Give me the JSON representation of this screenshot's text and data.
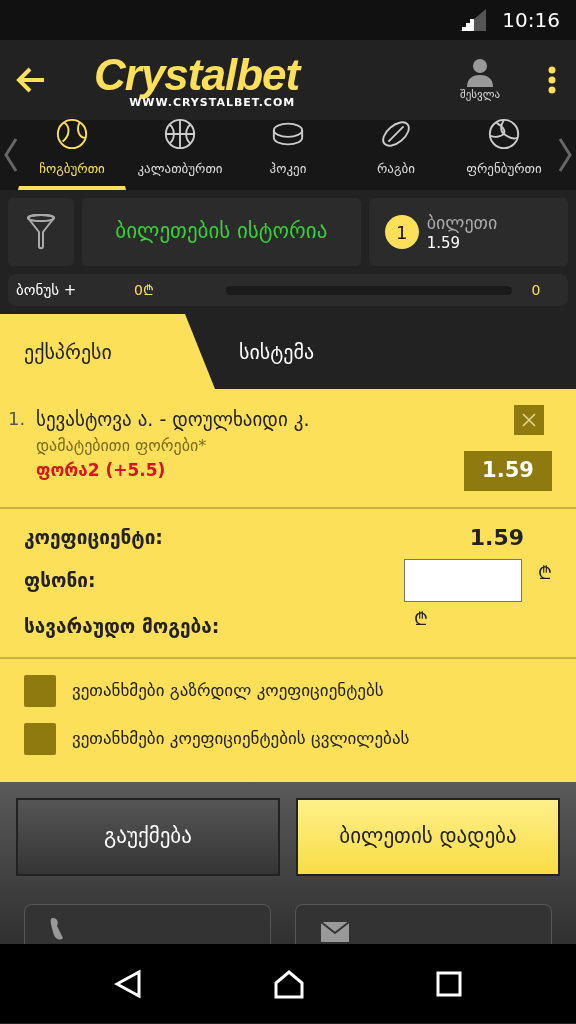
{
  "status_bar": {
    "time": "10:16"
  },
  "header": {
    "logo": "Crystalbet",
    "site": "WWW.CRYSTALBET.COM",
    "login": "შესვლა"
  },
  "sports": [
    {
      "kind": "tennis",
      "label": "ჩოგბურთი",
      "selected": true
    },
    {
      "kind": "basketball",
      "label": "კალათბურთი",
      "selected": false
    },
    {
      "kind": "hockey",
      "label": "ჰოკეი",
      "selected": false
    },
    {
      "kind": "rugby",
      "label": "რაგბი",
      "selected": false
    },
    {
      "kind": "volleyball",
      "label": "ფრენბურთი",
      "selected": false
    }
  ],
  "history_button": "ბილეთების ისტორია",
  "ticket_counter": {
    "count": "1",
    "label": "ბილეთი",
    "odds": "1.59"
  },
  "bonus": {
    "label": "ბონუს +",
    "amount": "0₾",
    "count": "0"
  },
  "bet_tabs": [
    {
      "label": "ექსპრესი",
      "selected": true
    },
    {
      "label": "სისტემა",
      "selected": false
    }
  ],
  "selections": [
    {
      "number": "1.",
      "event": "სევასტოვა ა. - დოულხაიდი კ.",
      "market": "დამატებითი ფორები*",
      "pick": "ფორა2 (+5.5)",
      "odds": "1.59"
    }
  ],
  "summary": {
    "odds_label": "კოეფიციენტი:",
    "odds": "1.59",
    "stake_label": "ფსონი:",
    "stake_currency": "₾",
    "winnings_label": "სავარაუდო მოგება:",
    "winnings_currency": "₾"
  },
  "options": [
    {
      "label": "ვეთანხმები გაზრდილ კოეფიციენტებს",
      "checked": false
    },
    {
      "label": "ვეთანხმები კოეფიციენტების ცვლილებას",
      "checked": false
    }
  ],
  "actions": {
    "cancel": "გაუქმება",
    "place": "ბილეთის დადება"
  },
  "contacts": [
    {
      "kind": "phone"
    },
    {
      "kind": "email"
    }
  ]
}
